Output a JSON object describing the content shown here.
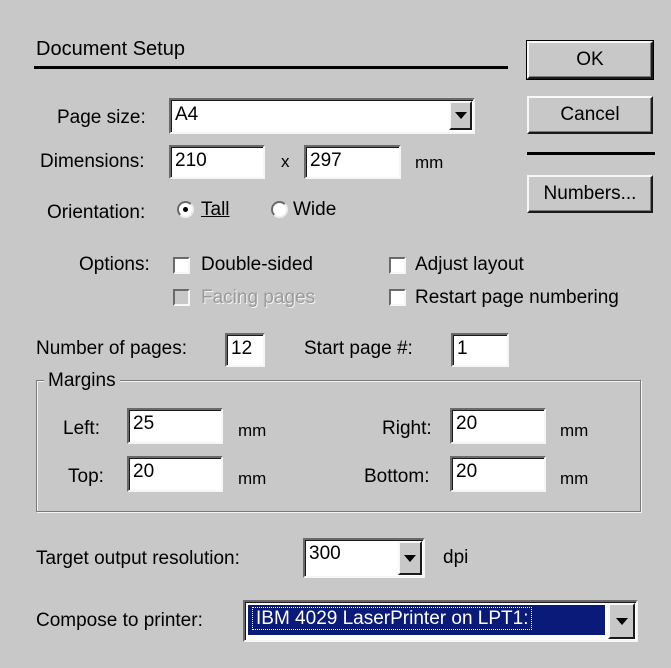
{
  "title": "Document Setup",
  "buttons": {
    "ok": "OK",
    "cancel": "Cancel",
    "numbers": "Numbers..."
  },
  "page_size": {
    "label": "Page size:",
    "value": "A4"
  },
  "dimensions": {
    "label": "Dimensions:",
    "width": "210",
    "separator": "x",
    "height": "297",
    "unit": "mm"
  },
  "orientation": {
    "label": "Orientation:",
    "tall": "Tall",
    "wide": "Wide",
    "selected": "Tall"
  },
  "options": {
    "label": "Options:",
    "double_sided": {
      "label": "Double-sided",
      "checked": false
    },
    "facing_pages": {
      "label": "Facing pages",
      "checked": false,
      "disabled": true
    },
    "adjust_layout": {
      "label": "Adjust layout",
      "checked": false
    },
    "restart_numbering": {
      "label": "Restart page numbering",
      "checked": false
    }
  },
  "pages": {
    "number_label": "Number of pages:",
    "number_value": "12",
    "start_label": "Start page #:",
    "start_value": "1"
  },
  "margins": {
    "title": "Margins",
    "left_label": "Left:",
    "left": "25",
    "right_label": "Right:",
    "right": "20",
    "top_label": "Top:",
    "top": "20",
    "bottom_label": "Bottom:",
    "bottom": "20",
    "unit": "mm"
  },
  "resolution": {
    "label": "Target output resolution:",
    "value": "300",
    "unit": "dpi"
  },
  "printer": {
    "label": "Compose to printer:",
    "value": "IBM 4029 LaserPrinter on LPT1:"
  }
}
